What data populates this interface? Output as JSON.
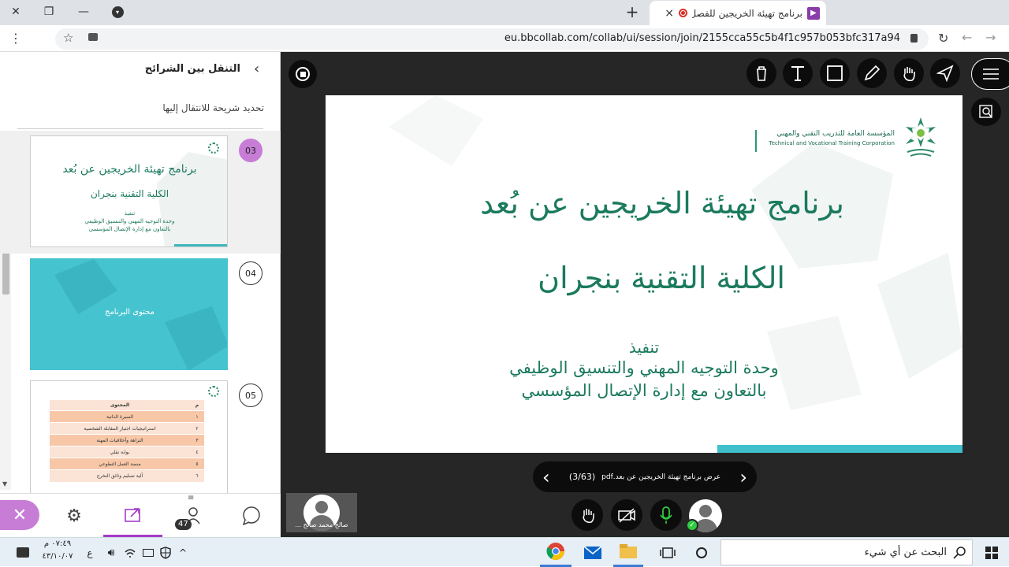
{
  "browser": {
    "tab_title": "برنامج تهيئة الخريجين للفصل ال",
    "new_tab": "+",
    "tab_close": "×",
    "url": "eu.bbcollab.com/collab/ui/session/join/2155cca55c5b4f1c957b053bfc317a94"
  },
  "panel": {
    "header": "التنقل بين الشرائح",
    "subheader": "تحديد شريحة للانتقال إليها",
    "slides": [
      {
        "number": "03",
        "title": "برنامج تهيئة الخريجين عن بُعد",
        "subtitle": "الكلية التقنية بنجران",
        "line1": "تنفيذ",
        "line2": "وحدة التوجيه المهني والتنسيق الوظيفي",
        "line3": "بالتعاون مع إدارة الإتصال المؤسسي"
      },
      {
        "number": "04",
        "title": "محتوى البرنامج"
      },
      {
        "number": "05",
        "header": [
          "م",
          "المحتوى"
        ],
        "rows": [
          [
            "١",
            "السيرة الذاتية"
          ],
          [
            "٢",
            "استراتيجيات اجتياز المقابلة الشخصية"
          ],
          [
            "٣",
            "النزاهة وأخلاقيات المهنة"
          ],
          [
            "٤",
            "بوابة نقلي"
          ],
          [
            "٥",
            "منصة العمل التطوعي"
          ],
          [
            "٦",
            "آلية تسليم وثائق التخرج"
          ]
        ]
      }
    ],
    "participants_count": "47"
  },
  "slide": {
    "org_ar": "المؤسسة العامة للتدريب التقني والمهني",
    "org_en": "Technical and Vocational Training Corporation",
    "title": "برنامج تهيئة الخريجين عن بُعد",
    "subtitle": "الكلية التقنية بنجران",
    "line1": "تنفيذ",
    "line2": "وحدة التوجيه المهني والتنسيق الوظيفي",
    "line3": "بالتعاون مع إدارة الإتصال المؤسسي"
  },
  "slidenav": {
    "filename": "عرض برنامج تهيئة الخريجين عن بعد.pdf",
    "page": "(3/63)"
  },
  "presenter": {
    "name": "صالح محمد صالح ..."
  },
  "taskbar": {
    "search_placeholder": "البحث عن أي شيء",
    "time": "٠٧:٤٩ م",
    "date": "٤٣/١٠/٠٧",
    "lang": "ع"
  },
  "colors": {
    "accent_purple": "#c77dd6",
    "slide_green": "#1b7a5e",
    "teal": "#3fc0cc"
  }
}
